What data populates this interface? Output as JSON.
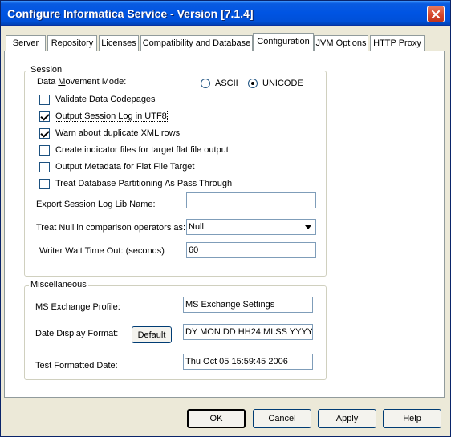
{
  "window": {
    "title": "Configure Informatica Service - Version [7.1.4]"
  },
  "tabs": [
    {
      "label": "Server"
    },
    {
      "label": "Repository"
    },
    {
      "label": "Licenses"
    },
    {
      "label": "Compatibility and Database"
    },
    {
      "label": "Configuration",
      "active": true
    },
    {
      "label": "JVM Options"
    },
    {
      "label": "HTTP Proxy"
    }
  ],
  "session": {
    "legend": "Session",
    "data_movement_label": "Data Movement Mode:",
    "radio_ascii": "ASCII",
    "radio_unicode": "UNICODE",
    "selected_mode": "UNICODE",
    "checkboxes": [
      {
        "label": "Validate Data Codepages",
        "checked": false
      },
      {
        "label": "Output Session Log in UTF8",
        "checked": true
      },
      {
        "label": "Warn about duplicate XML rows",
        "checked": true
      },
      {
        "label": "Create indicator files for target flat file output",
        "checked": false
      },
      {
        "label": "Output Metadata for Flat File Target",
        "checked": false
      },
      {
        "label": "Treat Database Partitioning As Pass Through",
        "checked": false
      }
    ],
    "export_log_lib_label": "Export Session Log Lib Name:",
    "export_log_lib_value": "",
    "treat_null_label": "Treat Null in comparison operators as:",
    "treat_null_value": "Null",
    "writer_wait_label": "Writer Wait Time Out: (seconds)",
    "writer_wait_value": "60"
  },
  "misc": {
    "legend": "Miscellaneous",
    "exchange_profile_label": "MS Exchange Profile:",
    "exchange_profile_value": "MS Exchange Settings",
    "date_format_label": "Date Display Format:",
    "default_button": "Default",
    "date_format_value": "DY MON DD HH24:MI:SS YYYY",
    "test_date_label": "Test Formatted Date:",
    "test_date_value": "Thu Oct 05 15:59:45 2006"
  },
  "buttons": {
    "ok": "OK",
    "cancel": "Cancel",
    "apply": "Apply",
    "help": "Help"
  }
}
